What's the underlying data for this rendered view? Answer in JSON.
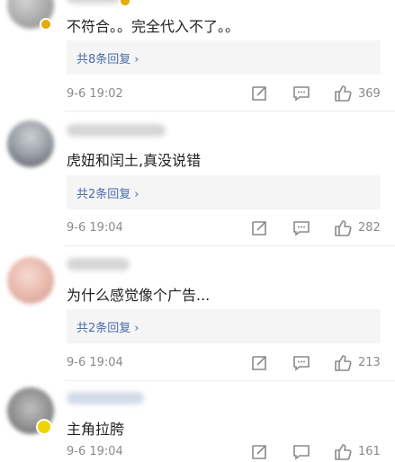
{
  "comments": [
    {
      "text": "不符合。。完全代入不了。。",
      "replies_label": "共8条回复",
      "time": "9-6 19:02",
      "likes": "369"
    },
    {
      "text": "虎妞和闰土,真没说错",
      "replies_label": "共2条回复",
      "time": "9-6 19:04",
      "likes": "282"
    },
    {
      "text": "为什么感觉像个广告...",
      "replies_label": "共2条回复",
      "time": "9-6 19:04",
      "likes": "213"
    },
    {
      "text": "主角拉胯",
      "time": "9-6 19:04",
      "likes": "161"
    }
  ],
  "icons": {
    "share": "share-icon",
    "comment": "comment-icon",
    "like": "thumbs-up-icon",
    "replies_chevron": "chevron-right-icon"
  },
  "colors": {
    "reply_link": "#4a6cab",
    "meta_text": "#8a8a8a",
    "reply_box_bg": "#f5f5f5",
    "badge": "#e8a900"
  }
}
